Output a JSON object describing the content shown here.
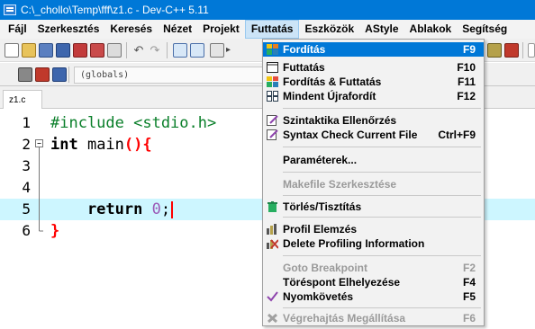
{
  "window": {
    "title": "C:\\_chollo\\Temp\\fff\\z1.c - Dev-C++ 5.11"
  },
  "menubar": {
    "items": [
      "Fájl",
      "Szerkesztés",
      "Keresés",
      "Nézet",
      "Projekt",
      "Futtatás",
      "Eszközök",
      "AStyle",
      "Ablakok",
      "Segítség"
    ],
    "active": "Futtatás"
  },
  "toolbar": {
    "scope_combo": "(globals)"
  },
  "tabs": [
    {
      "label": "z1.c"
    }
  ],
  "editor": {
    "lines": [
      {
        "number": "1",
        "text": "#include <stdio.h>"
      },
      {
        "number": "2",
        "text": "int main(){"
      },
      {
        "number": "3",
        "text": ""
      },
      {
        "number": "4",
        "text": ""
      },
      {
        "number": "5",
        "text": "    return 0;"
      },
      {
        "number": "6",
        "text": "}"
      }
    ],
    "highlighted_line": "5"
  },
  "run_menu": {
    "items": [
      {
        "label": "Fordítás",
        "shortcut": "F9",
        "icon": "compile-icon",
        "selected": true
      },
      {
        "label": "Futtatás",
        "shortcut": "F10",
        "icon": "run-window-icon"
      },
      {
        "label": "Fordítás & Futtatás",
        "shortcut": "F11",
        "icon": "compile-run-icon"
      },
      {
        "label": "Mindent Újrafordít",
        "shortcut": "F12",
        "icon": "rebuild-all-icon"
      },
      {
        "label": "Szintaktika Ellenőrzés",
        "shortcut": "",
        "icon": "syntax-check-icon"
      },
      {
        "label": "Syntax Check Current File",
        "shortcut": "Ctrl+F9",
        "icon": "syntax-check-file-icon"
      },
      {
        "label": "Paraméterek...",
        "shortcut": "",
        "icon": ""
      },
      {
        "label": "Makefile Szerkesztése",
        "shortcut": "",
        "icon": "",
        "disabled": true
      },
      {
        "label": "Törlés/Tisztítás",
        "shortcut": "",
        "icon": "clean-icon"
      },
      {
        "label": "Profil Elemzés",
        "shortcut": "",
        "icon": "profile-icon"
      },
      {
        "label": "Delete Profiling Information",
        "shortcut": "",
        "icon": "delete-profile-icon"
      },
      {
        "label": "Goto Breakpoint",
        "shortcut": "F2",
        "icon": "",
        "disabled": true
      },
      {
        "label": "Töréspont Elhelyezése",
        "shortcut": "F4",
        "icon": ""
      },
      {
        "label": "Nyomkövetés",
        "shortcut": "F5",
        "icon": "debug-check-icon"
      },
      {
        "label": "Végrehajtás Megállítása",
        "shortcut": "F6",
        "icon": "stop-execution-icon",
        "disabled": true
      }
    ]
  },
  "colors": {
    "accent": "#0078d7",
    "menu_active": "#cce4f7",
    "line_highlight": "#cdf6ff",
    "preprocessor": "#0a7f2a",
    "brace": "#ff0000",
    "number": "#9b59b6"
  }
}
